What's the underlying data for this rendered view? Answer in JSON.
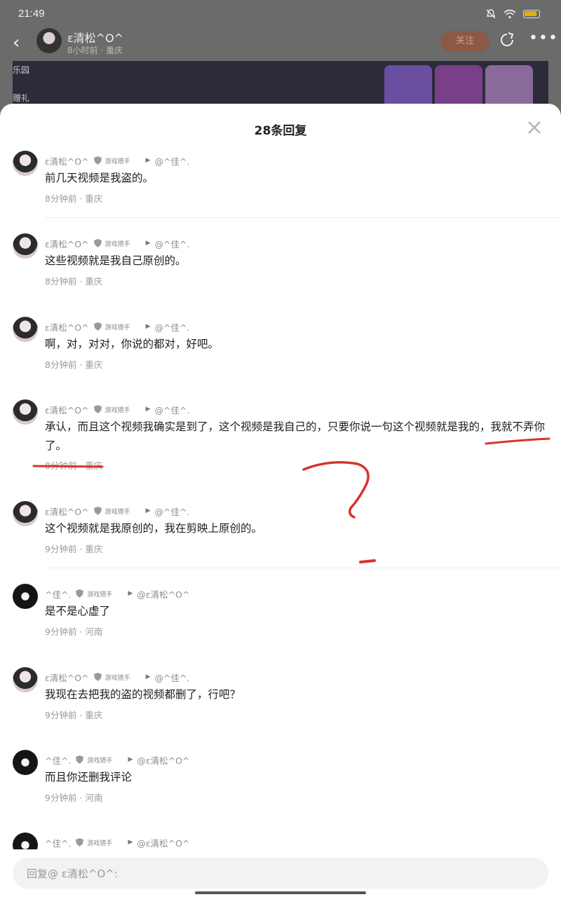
{
  "status_bar": {
    "time": "21:49"
  },
  "background": {
    "author_name": "ε清松^O^",
    "author_meta": "8小时前 · 重庆",
    "follow_label": "关注",
    "banner_labels": [
      "乐园",
      "赠礼"
    ]
  },
  "sheet": {
    "title": "28条回复"
  },
  "badge_text": "游戏猎手",
  "comments": [
    {
      "name": "ε清松^O^",
      "reply_to": "@^佳^.",
      "text": "前几天视频是我盗的。",
      "meta": "8分钟前 · 重庆"
    },
    {
      "name": "ε清松^O^",
      "reply_to": "@^佳^.",
      "text": "这些视频就是我自己原创的。",
      "meta": "8分钟前 · 重庆"
    },
    {
      "name": "ε清松^O^",
      "reply_to": "@^佳^.",
      "text": "啊，对，对对，你说的都对，好吧。",
      "meta": "8分钟前 · 重庆"
    },
    {
      "name": "ε清松^O^",
      "reply_to": "@^佳^.",
      "text": "承认，而且这个视频我确实是到了，这个视频是我自己的，只要你说一句这个视频就是我的，我就不弄你了。",
      "meta": "8分钟前 · 重庆"
    },
    {
      "name": "ε清松^O^",
      "reply_to": "@^佳^.",
      "text": "这个视频就是我原创的，我在剪映上原创的。",
      "meta": "9分钟前 · 重庆"
    },
    {
      "name": "^佳^.",
      "reply_to": "@ε清松^O^",
      "text": "是不是心虚了",
      "meta": "9分钟前 · 河南"
    },
    {
      "name": "ε清松^O^",
      "reply_to": "@^佳^.",
      "text": "我现在去把我的盗的视频都删了，行吧？",
      "meta": "9分钟前 · 重庆"
    },
    {
      "name": "^佳^.",
      "reply_to": "@ε清松^O^",
      "text": "而且你还删我评论",
      "meta": "9分钟前 · 河南"
    },
    {
      "name": "^佳^.",
      "reply_to": "@ε清松^O^",
      "text": "",
      "meta": ""
    }
  ],
  "reply_bar": {
    "placeholder": "回复@ ε清松^O^:"
  },
  "colors": {
    "annotation": "#d8332e",
    "sheet_bg": "#ffffff",
    "follow": "#8a5a46"
  }
}
